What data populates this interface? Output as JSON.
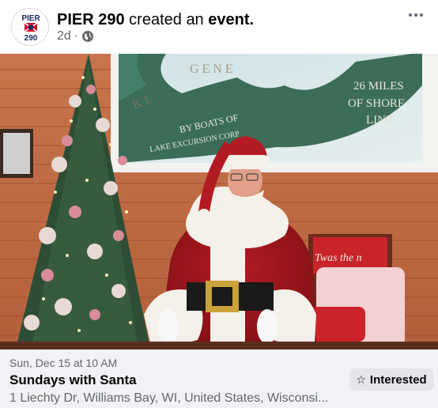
{
  "post": {
    "author": "PIER 290",
    "action": "created an",
    "action_object": "event.",
    "timestamp": "2d",
    "separator": "·",
    "privacy_icon": "globe-icon",
    "menu_icon": "more-dots-icon"
  },
  "avatar": {
    "logo_text_top": "PIER",
    "logo_text_bottom": "290"
  },
  "photo": {
    "sign_text_1": "26 MILES",
    "sign_text_2": "OF SHORE",
    "sign_text_3": "LINE",
    "sign_text_4": "BY BOATS OF",
    "sign_text_5": "LAKE EXCURSION CORP",
    "pillow_text": "Twas the n"
  },
  "event": {
    "date": "Sun, Dec 15 at 10 AM",
    "title": "Sundays with Santa",
    "location": "1 Liechty Dr, Williams Bay, WI, United States, Wisconsi...",
    "interested_label": "Interested",
    "interested_icon": "star-icon"
  },
  "colors": {
    "brand_red": "#c8102e",
    "brand_navy": "#1b2a5c",
    "footer_bg": "#f0f2f5",
    "button_bg": "#e4e6eb",
    "secondary_text": "#65676b"
  }
}
